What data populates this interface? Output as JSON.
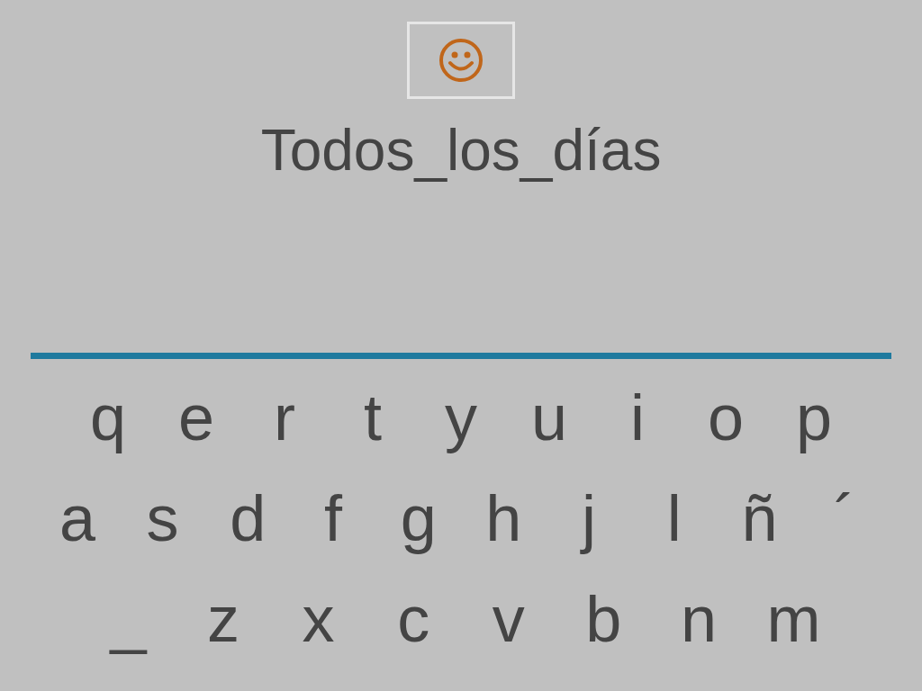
{
  "word": "Todos_los_días",
  "keyboard": {
    "rows": [
      [
        "q",
        "e",
        "r",
        "t",
        "y",
        "u",
        "i",
        "o",
        "p"
      ],
      [
        "a",
        "s",
        "d",
        "f",
        "g",
        "h",
        "j",
        "l",
        "ñ",
        "´"
      ],
      [
        "_",
        "z",
        "x",
        "c",
        "v",
        "b",
        "n",
        "m"
      ]
    ]
  }
}
